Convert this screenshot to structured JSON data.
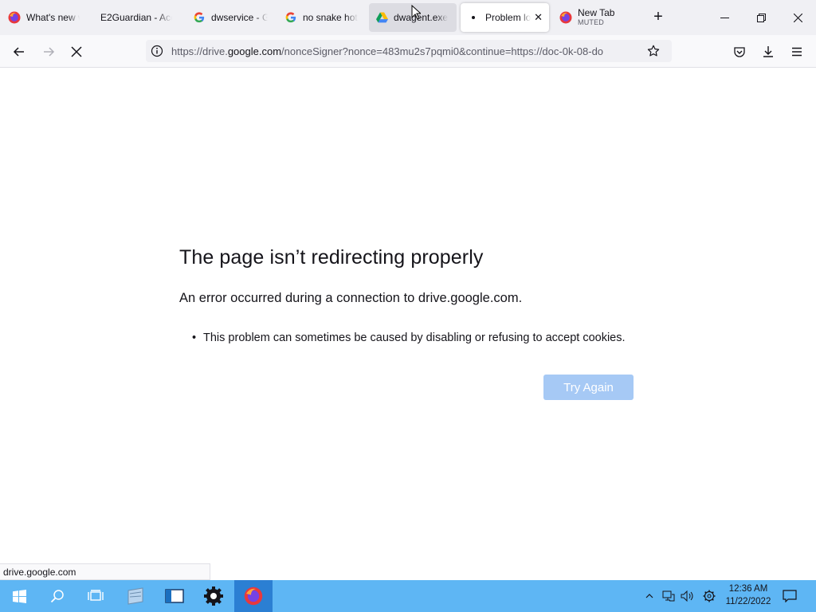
{
  "tabs": [
    {
      "title": "What's new w",
      "icon": "firefox-icon",
      "state": "normal"
    },
    {
      "title": "E2Guardian - Acce",
      "icon": "none",
      "state": "normal"
    },
    {
      "title": "dwservice - G",
      "icon": "google-icon",
      "state": "normal"
    },
    {
      "title": "no snake hota",
      "icon": "google-icon",
      "state": "normal"
    },
    {
      "title": "dwagent.exe",
      "icon": "google-drive-icon",
      "state": "hover"
    },
    {
      "title": "Problem lo",
      "icon": "loading-dot-icon",
      "state": "active"
    },
    {
      "title": "New Tab",
      "subtitle": "MUTED",
      "icon": "firefox-icon",
      "state": "normal"
    }
  ],
  "url": {
    "prefix": "https://drive.",
    "domain": "google.com",
    "suffix": "/nonceSigner?nonce=483mu2s7pqmi0&continue=https://doc-0k-08-do"
  },
  "error": {
    "title": "The page isn’t redirecting properly",
    "description": "An error occurred during a connection to drive.google.com.",
    "items": [
      "This problem can sometimes be caused by disabling or refusing to accept cookies."
    ],
    "button": "Try Again"
  },
  "status_text": "drive.google.com",
  "clock": {
    "time": "12:36 AM",
    "date": "11/22/2022"
  },
  "colors": {
    "tabstrip_bg": "#f0f0f4",
    "taskbar_bg": "#5eb6f4",
    "button_disabled_bg": "#a6c9f5"
  }
}
